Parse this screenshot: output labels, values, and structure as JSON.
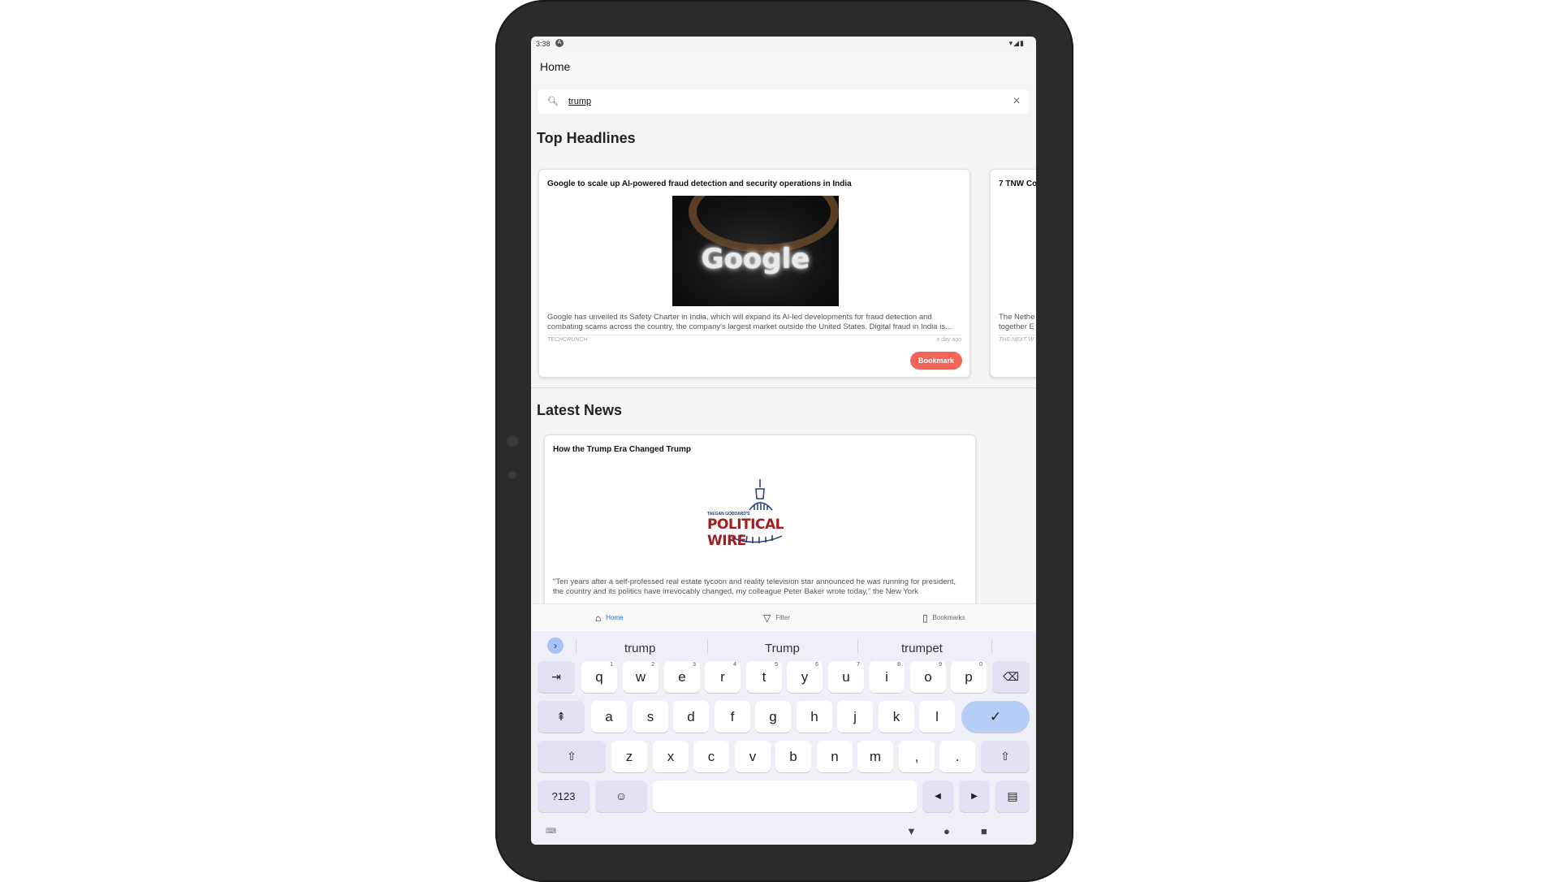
{
  "status": {
    "time": "3:38",
    "notif_icon": "A",
    "sys_icons": "▾◢▮"
  },
  "appbar": {
    "title": "Home"
  },
  "search": {
    "value": "trump",
    "search_icon": "search-icon",
    "clear_icon": "close-icon"
  },
  "sections": {
    "top_headlines": "Top Headlines",
    "latest_news": "Latest News"
  },
  "headlines": [
    {
      "title": "Google to scale up AI-powered fraud detection and security operations in India",
      "image_text": "Google",
      "description_1": "Google has unveiled its Safety Charter in India, which will expand its AI-led developments for fraud detection and",
      "description_2": "combating scams across the country, the company's largest market outside the United States. Digital fraud in India is...",
      "source": "TECHCRUNCH",
      "time": "a day ago",
      "bookmark_label": "Bookmark"
    },
    {
      "title": "7 TNW Co",
      "description_1": "The Nethe",
      "description_2": "together E",
      "source": "THE NEXT W"
    }
  ],
  "latest": [
    {
      "title": "How the Trump Era Changed Trump",
      "image_small": "TAEGAN GODDARD'S",
      "image_big": "POLITICAL WIRE",
      "description_1": "\"Ten years after a self-professed real estate tycoon and reality television star announced he was running for president,",
      "description_2": "the country and its politics have irrevocably changed, my colleague Peter Baker wrote today,\" the New York"
    }
  ],
  "bottom_nav": {
    "home": "Home",
    "filter": "Filter",
    "bookmarks": "Bookmarks"
  },
  "keyboard": {
    "suggestions": [
      "trump",
      "Trump",
      "trumpet"
    ],
    "row1": [
      {
        "k": "q",
        "n": "1"
      },
      {
        "k": "w",
        "n": "2"
      },
      {
        "k": "e",
        "n": "3"
      },
      {
        "k": "r",
        "n": "4"
      },
      {
        "k": "t",
        "n": "5"
      },
      {
        "k": "y",
        "n": "6"
      },
      {
        "k": "u",
        "n": "7"
      },
      {
        "k": "i",
        "n": "8"
      },
      {
        "k": "o",
        "n": "9"
      },
      {
        "k": "p",
        "n": "0"
      }
    ],
    "row2": [
      "a",
      "s",
      "d",
      "f",
      "g",
      "h",
      "j",
      "k",
      "l"
    ],
    "row3": [
      "z",
      "x",
      "c",
      "v",
      "b",
      "n",
      "m",
      ",",
      "."
    ],
    "tab_key": "⇥",
    "backspace_key": "⌫",
    "caps_key": "⇞",
    "enter_key": "✓",
    "shift_key": "⇧",
    "symbols_key": "?123",
    "emoji_key": "☺",
    "left_key": "◀",
    "right_key": "▶",
    "hide_key": "▤",
    "sys_back": "▼",
    "sys_home": "●",
    "sys_recents": "■",
    "sys_keyboard": "⌨"
  },
  "colors": {
    "accent": "#1a73e8",
    "bookmark": "#f2665a",
    "brand_red": "#a11d21"
  }
}
